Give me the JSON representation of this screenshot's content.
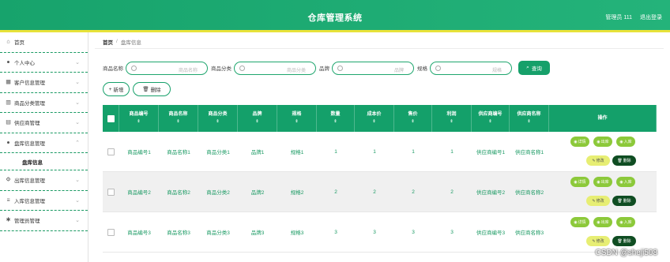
{
  "app": {
    "title": "仓库管理系统",
    "user_label": "管理员 111",
    "logout_label": "退出登录"
  },
  "sidebar": {
    "items": [
      {
        "label": "首页",
        "icon": "home-icon",
        "has_chevron": false
      },
      {
        "label": "个人中心",
        "icon": "user-icon",
        "has_chevron": true
      },
      {
        "label": "客户信息管理",
        "icon": "grid-icon",
        "has_chevron": true
      },
      {
        "label": "商品分类管理",
        "icon": "table-icon",
        "has_chevron": true
      },
      {
        "label": "供应商管理",
        "icon": "store-icon",
        "has_chevron": true
      },
      {
        "label": "盘库信息管理",
        "icon": "user-icon",
        "has_chevron": true
      },
      {
        "label": "出库信息管理",
        "icon": "gear-icon",
        "has_chevron": true
      },
      {
        "label": "入库信息管理",
        "icon": "list-icon",
        "has_chevron": true
      },
      {
        "label": "管理员管理",
        "icon": "bulb-icon",
        "has_chevron": true
      }
    ],
    "subitem": "盘库信息"
  },
  "breadcrumb": {
    "home": "首页",
    "separator": "/",
    "current": "盘库信息"
  },
  "search": {
    "fields": [
      {
        "label": "商品名称",
        "placeholder": "商品名称"
      },
      {
        "label": "商品分类",
        "placeholder": "商品分类"
      },
      {
        "label": "品牌",
        "placeholder": "品牌"
      },
      {
        "label": "规格",
        "placeholder": "规格"
      }
    ],
    "button": "查询"
  },
  "actions": {
    "add": "新增",
    "delete": "删除"
  },
  "table": {
    "headers": [
      "商品编号",
      "商品名称",
      "商品分类",
      "品牌",
      "规格",
      "数量",
      "成本价",
      "售价",
      "利润",
      "供应商编号",
      "供应商名称",
      "操作"
    ],
    "sort_mark": "⇕",
    "rows": [
      [
        "商品编号1",
        "商品名称1",
        "商品分类1",
        "品牌1",
        "规格1",
        "1",
        "1",
        "1",
        "1",
        "供应商编号1",
        "供应商名称1"
      ],
      [
        "商品编号2",
        "商品名称2",
        "商品分类2",
        "品牌2",
        "规格2",
        "2",
        "2",
        "2",
        "2",
        "供应商编号2",
        "供应商名称2"
      ],
      [
        "商品编号3",
        "商品名称3",
        "商品分类3",
        "品牌3",
        "规格3",
        "3",
        "3",
        "3",
        "3",
        "供应商编号3",
        "供应商名称3"
      ]
    ],
    "row_actions": {
      "detail": "详情",
      "outbound": "出库",
      "inbound": "入库",
      "edit": "修改",
      "delete": "删除"
    }
  },
  "watermark": "CSDN @sheji508",
  "colors": {
    "primary": "#16a06a",
    "accent_bar": "#e8e23a",
    "op_green": "#8cc93a",
    "op_yellow": "#e7ee73",
    "op_dark": "#0f4d22"
  }
}
